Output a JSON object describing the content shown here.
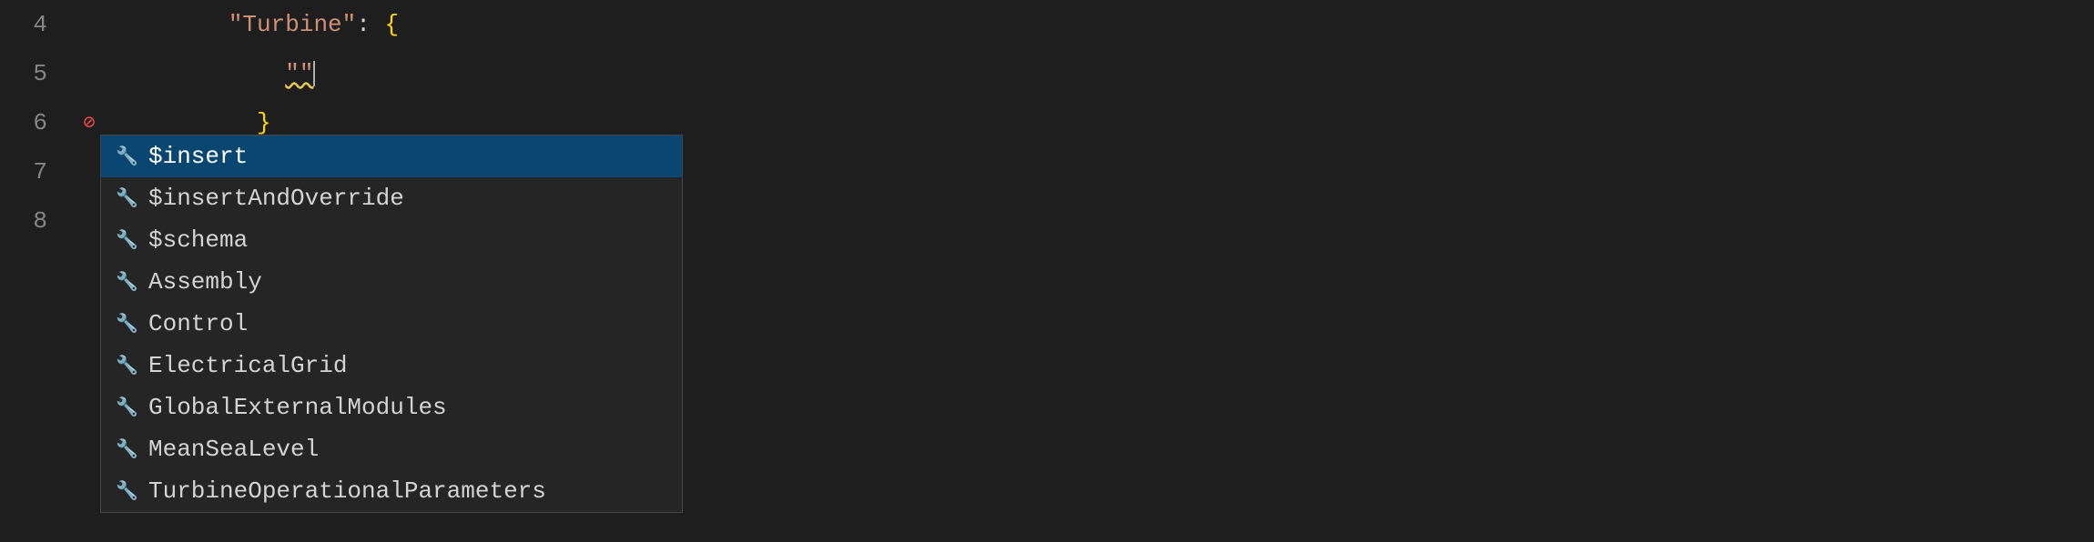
{
  "editor": {
    "background": "#1e1e1e",
    "lines": [
      {
        "number": "4",
        "content": "\"Turbine\": {",
        "tokens": [
          {
            "text": "\"Turbine\"",
            "type": "key"
          },
          {
            "text": ": ",
            "type": "punctuation"
          },
          {
            "text": "{",
            "type": "brace-yellow"
          }
        ]
      },
      {
        "number": "5",
        "content": "    \"\"",
        "tokens": [
          {
            "text": "    \"\"",
            "type": "string-empty"
          }
        ],
        "hasCursor": true,
        "hasSquiggle": true
      },
      {
        "number": "6",
        "content": "  }",
        "tokens": [
          {
            "text": "  }",
            "type": "brace-yellow"
          }
        ],
        "hasGutterError": true
      },
      {
        "number": "7",
        "content": "",
        "tokens": []
      },
      {
        "number": "8",
        "content": "}",
        "tokens": [
          {
            "text": "}",
            "type": "brace-yellow"
          }
        ]
      }
    ]
  },
  "autocomplete": {
    "items": [
      {
        "id": "insert",
        "label": "$insert",
        "selected": true
      },
      {
        "id": "insertAndOverride",
        "label": "$insertAndOverride",
        "selected": false
      },
      {
        "id": "schema",
        "label": "$schema",
        "selected": false
      },
      {
        "id": "assembly",
        "label": "Assembly",
        "selected": false
      },
      {
        "id": "control",
        "label": "Control",
        "selected": false
      },
      {
        "id": "electricalGrid",
        "label": "ElectricalGrid",
        "selected": false
      },
      {
        "id": "globalExternalModules",
        "label": "GlobalExternalModules",
        "selected": false
      },
      {
        "id": "meanSeaLevel",
        "label": "MeanSeaLevel",
        "selected": false
      },
      {
        "id": "turbineOperationalParameters",
        "label": "TurbineOperationalParameters",
        "selected": false
      }
    ]
  }
}
